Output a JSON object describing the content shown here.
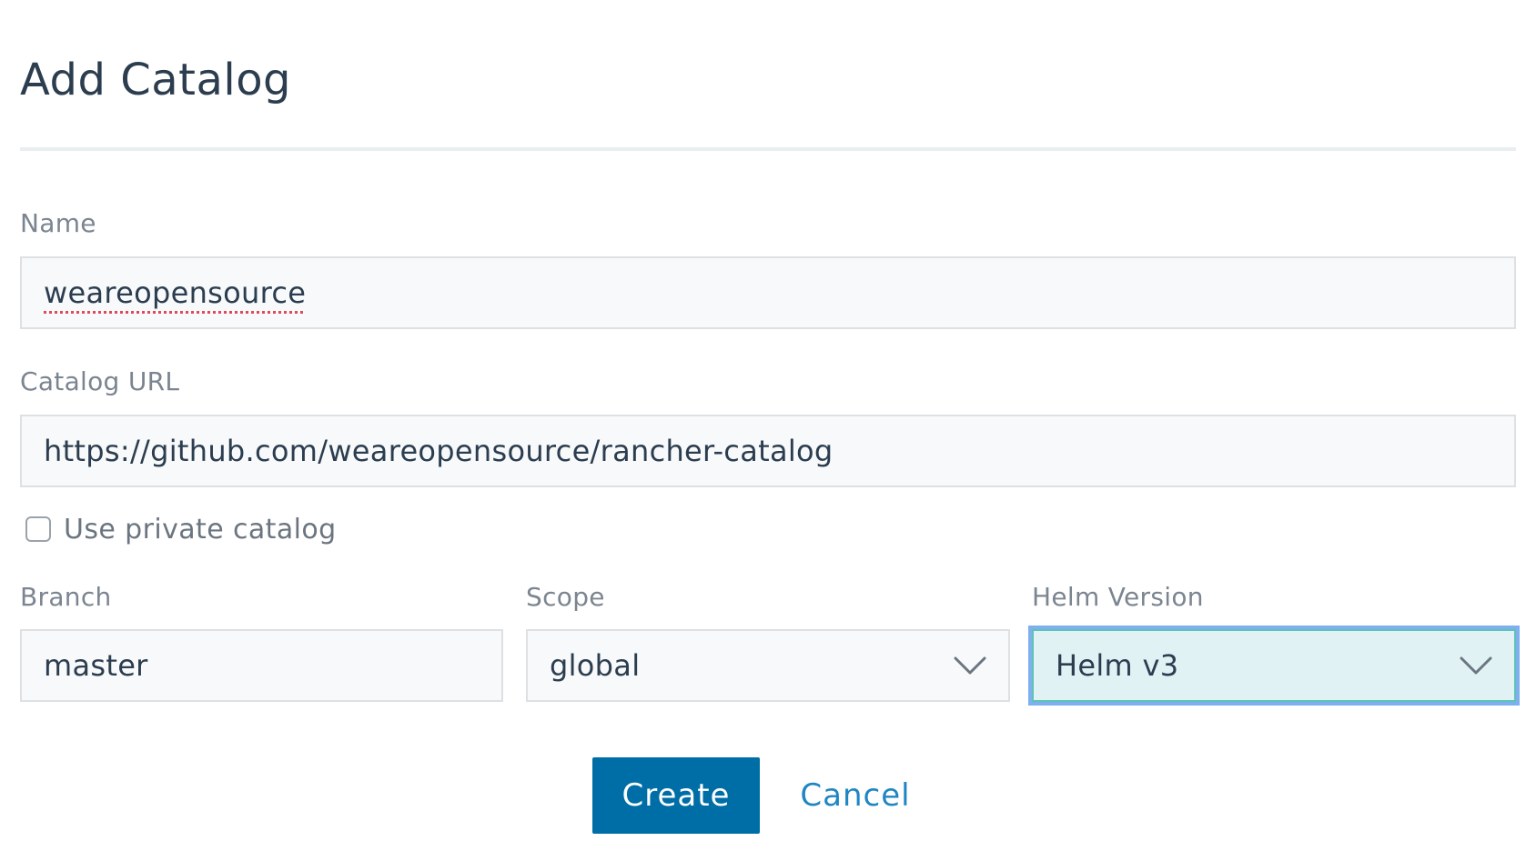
{
  "form": {
    "title": "Add Catalog",
    "name": {
      "label": "Name",
      "value": "weareopensource"
    },
    "catalog_url": {
      "label": "Catalog URL",
      "value": "https://github.com/weareopensource/rancher-catalog"
    },
    "private_catalog": {
      "label": "Use private catalog",
      "checked": false
    },
    "branch": {
      "label": "Branch",
      "value": "master"
    },
    "scope": {
      "label": "Scope",
      "selected": "global"
    },
    "helm_version": {
      "label": "Helm Version",
      "selected": "Helm v3"
    },
    "actions": {
      "create_label": "Create",
      "cancel_label": "Cancel"
    }
  },
  "icons": {
    "scope_chevron": "chevron-down-icon",
    "helm_chevron": "chevron-down-icon"
  },
  "colors": {
    "primary": "#006ea6",
    "link": "#1f86c3",
    "focus_ring": "#7eb0f0",
    "focus_fill": "#e0f2f4"
  }
}
